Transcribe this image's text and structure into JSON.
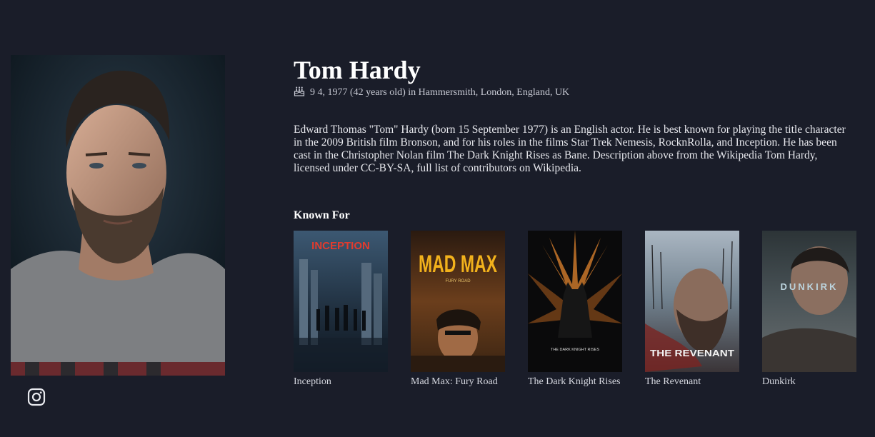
{
  "person": {
    "name": "Tom Hardy",
    "birth_info": "9 4, 1977 (42 years old) in Hammersmith, London, England, UK",
    "bio": "Edward Thomas \"Tom\" Hardy (born 15 September 1977) is an English actor. He is best known for playing the title character in the 2009 British film Bronson, and for his roles in the films Star Trek Nemesis, RocknRolla, and Inception. He has been cast in the Christopher Nolan film The Dark Knight Rises as Bane. Description above from the Wikipedia Tom Hardy, licensed under CC-BY-SA, full list of contributors on Wikipedia."
  },
  "icons": {
    "birthday": "birthday-cake-icon",
    "social": "instagram-icon"
  },
  "known_for": {
    "title": "Known For",
    "movies": [
      {
        "title": "Inception",
        "poster_text": "INCEPTION"
      },
      {
        "title": "Mad Max: Fury Road",
        "poster_text": "MAD MAX",
        "poster_subtext": "FURY ROAD"
      },
      {
        "title": "The Dark Knight Rises",
        "poster_text": "THE DARK KNIGHT RISES"
      },
      {
        "title": "The Revenant",
        "poster_text": "THE REVENANT"
      },
      {
        "title": "Dunkirk",
        "poster_text": "DUNKIRK"
      }
    ]
  },
  "colors": {
    "background": "#1a1d29",
    "text": "#e8e9ee"
  }
}
